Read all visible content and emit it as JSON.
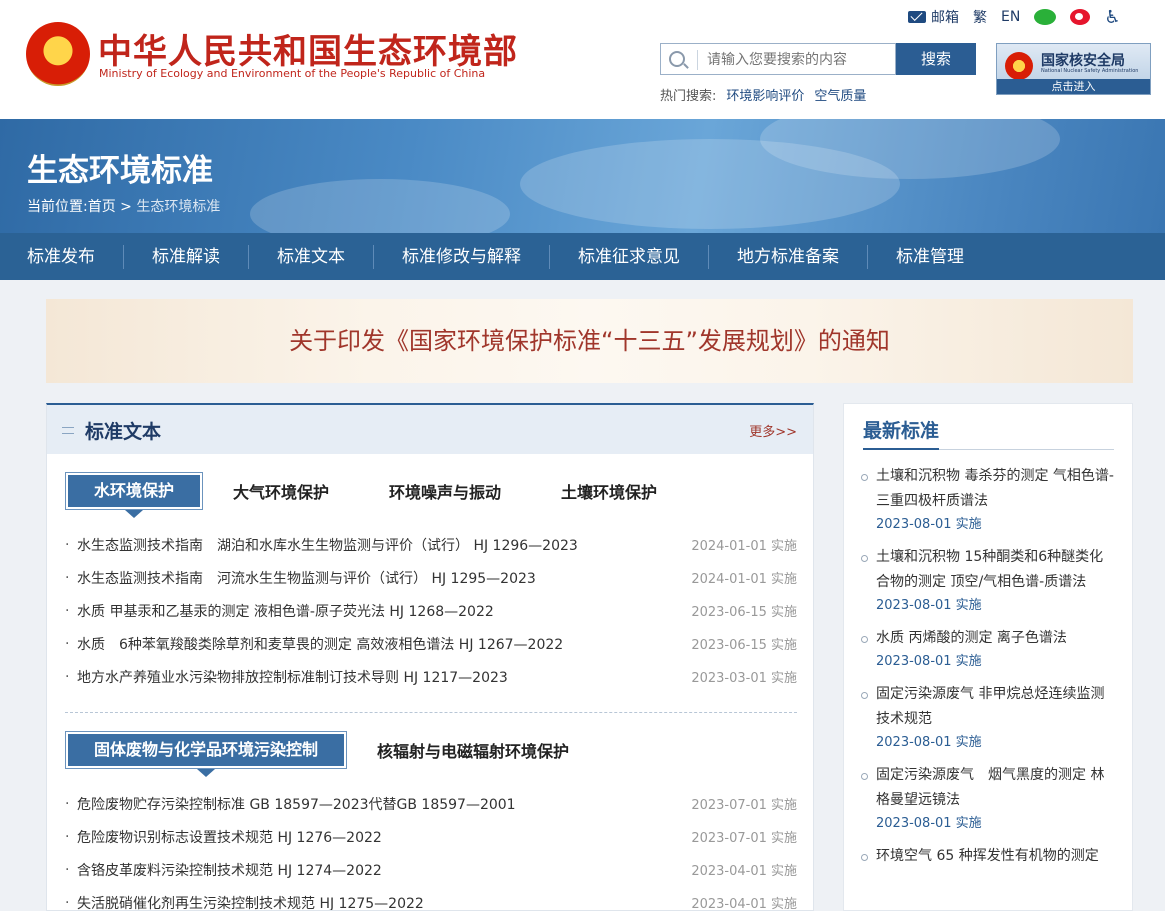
{
  "header": {
    "logo_cn": "中华人民共和国生态环境部",
    "logo_en": "Ministry of Ecology and Environment of the People's Republic of China",
    "topbar": {
      "mail": "邮箱",
      "traditional": "繁",
      "english": "EN"
    },
    "search": {
      "placeholder": "请输入您要搜索的内容",
      "button": "搜索"
    },
    "hot": {
      "label": "热门搜索:",
      "items": [
        "环境影响评价",
        "空气质量"
      ]
    },
    "nnsa": {
      "title": "国家核安全局",
      "subtitle": "National Nuclear Safety Administration",
      "enter": "点击进入"
    }
  },
  "banner": {
    "title": "生态环境标准",
    "breadcrumb": {
      "label": "当前位置:",
      "home": "首页",
      "sep": ">",
      "current": "生态环境标准"
    }
  },
  "nav": [
    "标准发布",
    "标准解读",
    "标准文本",
    "标准修改与解释",
    "标准征求意见",
    "地方标准备案",
    "标准管理"
  ],
  "notice": "关于印发《国家环境保护标准“十三五”发展规划》的通知",
  "main": {
    "title": "标准文本",
    "more": "更多>>",
    "tabs1": [
      "水环境保护",
      "大气环境保护",
      "环境噪声与振动",
      "土壤环境保护"
    ],
    "list1": [
      {
        "title": "水生态监测技术指南　湖泊和水库水生生物监测与评价（试行） HJ 1296—2023",
        "date": "2024-01-01 实施"
      },
      {
        "title": "水生态监测技术指南　河流水生生物监测与评价（试行） HJ 1295—2023",
        "date": "2024-01-01 实施"
      },
      {
        "title": "水质 甲基汞和乙基汞的测定 液相色谱-原子荧光法 HJ 1268—2022",
        "date": "2023-06-15 实施"
      },
      {
        "title": "水质　6种苯氧羧酸类除草剂和麦草畏的测定 高效液相色谱法 HJ 1267—2022",
        "date": "2023-06-15 实施"
      },
      {
        "title": "地方水产养殖业水污染物排放控制标准制订技术导则 HJ 1217—2023",
        "date": "2023-03-01 实施"
      }
    ],
    "tabs2": [
      "固体废物与化学品环境污染控制",
      "核辐射与电磁辐射环境保护"
    ],
    "list2": [
      {
        "title": "危险废物贮存污染控制标准 GB 18597—2023代替GB 18597—2001",
        "date": "2023-07-01 实施"
      },
      {
        "title": "危险废物识别标志设置技术规范 HJ 1276—2022",
        "date": "2023-07-01 实施"
      },
      {
        "title": "含铬皮革废料污染控制技术规范 HJ 1274—2022",
        "date": "2023-04-01 实施"
      },
      {
        "title": "失活脱硝催化剂再生污染控制技术规范 HJ 1275—2022",
        "date": "2023-04-01 实施"
      }
    ]
  },
  "side": {
    "title": "最新标准",
    "items": [
      {
        "title": "土壤和沉积物 毒杀芬的测定 气相色谱-三重四极杆质谱法",
        "date": "2023-08-01 实施"
      },
      {
        "title": "土壤和沉积物 15种酮类和6种醚类化合物的测定 顶空/气相色谱-质谱法",
        "date": "2023-08-01 实施"
      },
      {
        "title": "水质 丙烯酸的测定 离子色谱法",
        "date": "2023-08-01 实施"
      },
      {
        "title": "固定污染源废气 非甲烷总烃连续监测技术规范",
        "date": "2023-08-01 实施"
      },
      {
        "title": "固定污染源废气　烟气黑度的测定 林格曼望远镜法",
        "date": "2023-08-01 实施"
      },
      {
        "title": "环境空气 65 种挥发性有机物的测定",
        "date": ""
      }
    ]
  }
}
